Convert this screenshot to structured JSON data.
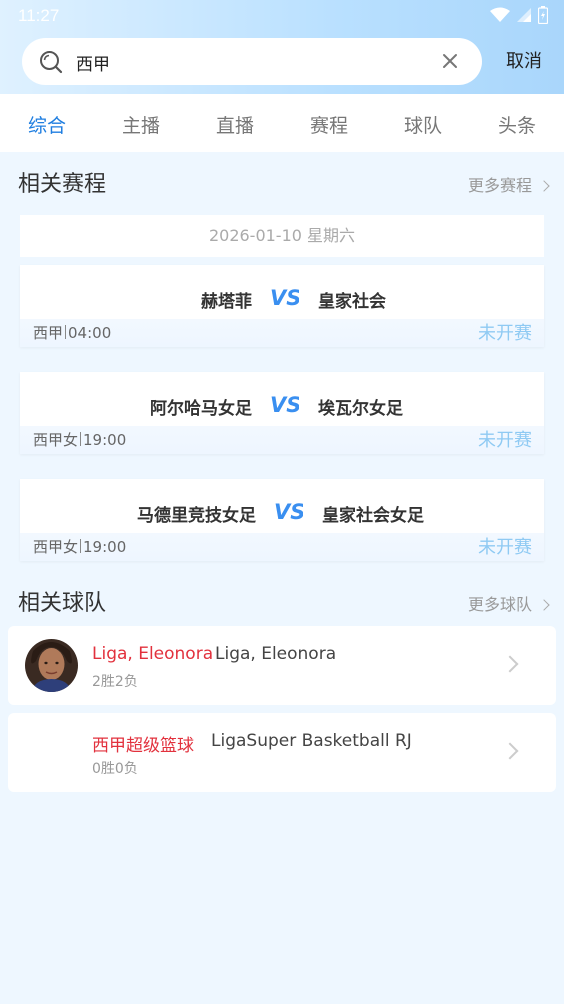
{
  "status_bar": {
    "time": "11:27"
  },
  "search": {
    "value": "西甲",
    "cancel_label": "取消"
  },
  "tabs": [
    {
      "label": "综合",
      "active": true
    },
    {
      "label": "主播"
    },
    {
      "label": "直播"
    },
    {
      "label": "赛程"
    },
    {
      "label": "球队"
    },
    {
      "label": "头条"
    }
  ],
  "schedule_section": {
    "title": "相关赛程",
    "more": "更多赛程"
  },
  "date_header": "2026-01-10 星期六",
  "matches": [
    {
      "home": "赫塔菲",
      "away": "皇家社会",
      "league": "西甲",
      "time": "04:00",
      "status": "未开赛"
    },
    {
      "home": "阿尔哈马女足",
      "away": "埃瓦尔女足",
      "league": "西甲女",
      "time": "19:00",
      "status": "未开赛"
    },
    {
      "home": "马德里竞技女足",
      "away": "皇家社会女足",
      "league": "西甲女",
      "time": "19:00",
      "status": "未开赛"
    }
  ],
  "teams_section": {
    "title": "相关球队",
    "more": "更多球队"
  },
  "teams": [
    {
      "name": "Liga, Eleonora",
      "name_en": "Liga, Eleonora",
      "record": "2胜2负",
      "has_avatar": true
    },
    {
      "name": "西甲超级篮球",
      "name_en": "LigaSuper Basketball RJ",
      "record": "0胜0负",
      "has_avatar": false
    }
  ],
  "colors": {
    "accent": "#1f7ee0",
    "team_name": "#e2313d",
    "status": "#8fcaf3"
  }
}
